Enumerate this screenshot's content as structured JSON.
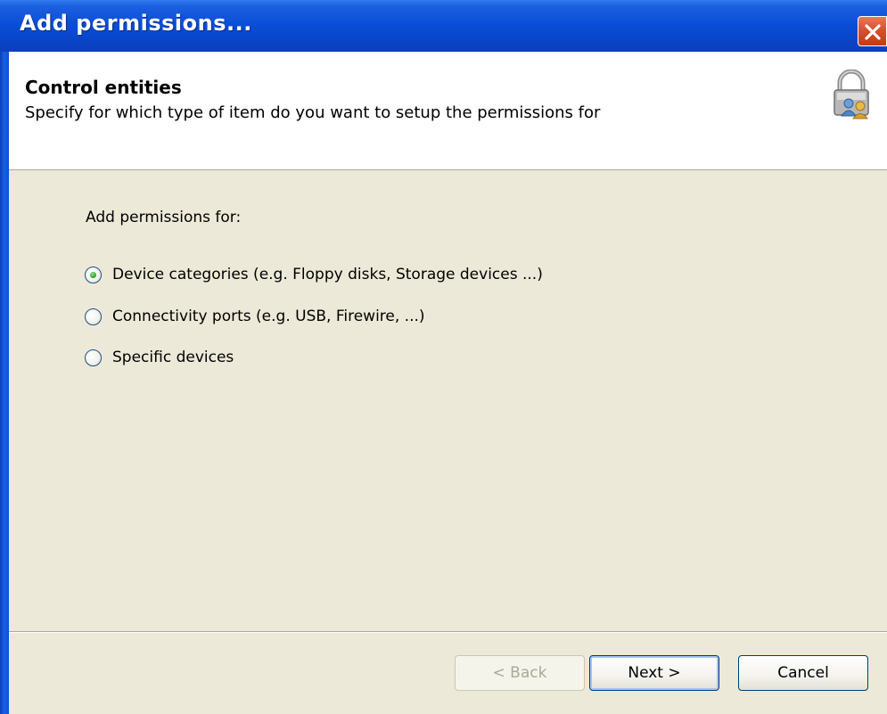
{
  "window": {
    "title": "Add permissions..."
  },
  "header": {
    "title": "Control entities",
    "subtitle": "Specify for which type of item do you want to setup the permissions for",
    "icon": "lock-users-icon"
  },
  "body": {
    "group_label": "Add permissions for:",
    "options": [
      {
        "label": "Device categories (e.g. Floppy disks, Storage devices ...)",
        "checked": true
      },
      {
        "label": "Connectivity ports (e.g. USB, Firewire, ...)",
        "checked": false
      },
      {
        "label": "Specific devices",
        "checked": false
      }
    ]
  },
  "buttons": {
    "back_label": "< Back",
    "next_label": "Next >",
    "cancel_label": "Cancel",
    "back_enabled": false
  },
  "colors": {
    "titlebar": "#0a4fd8",
    "face": "#ece9d8",
    "close": "#d8512d",
    "radio_check": "#2fa82f"
  }
}
